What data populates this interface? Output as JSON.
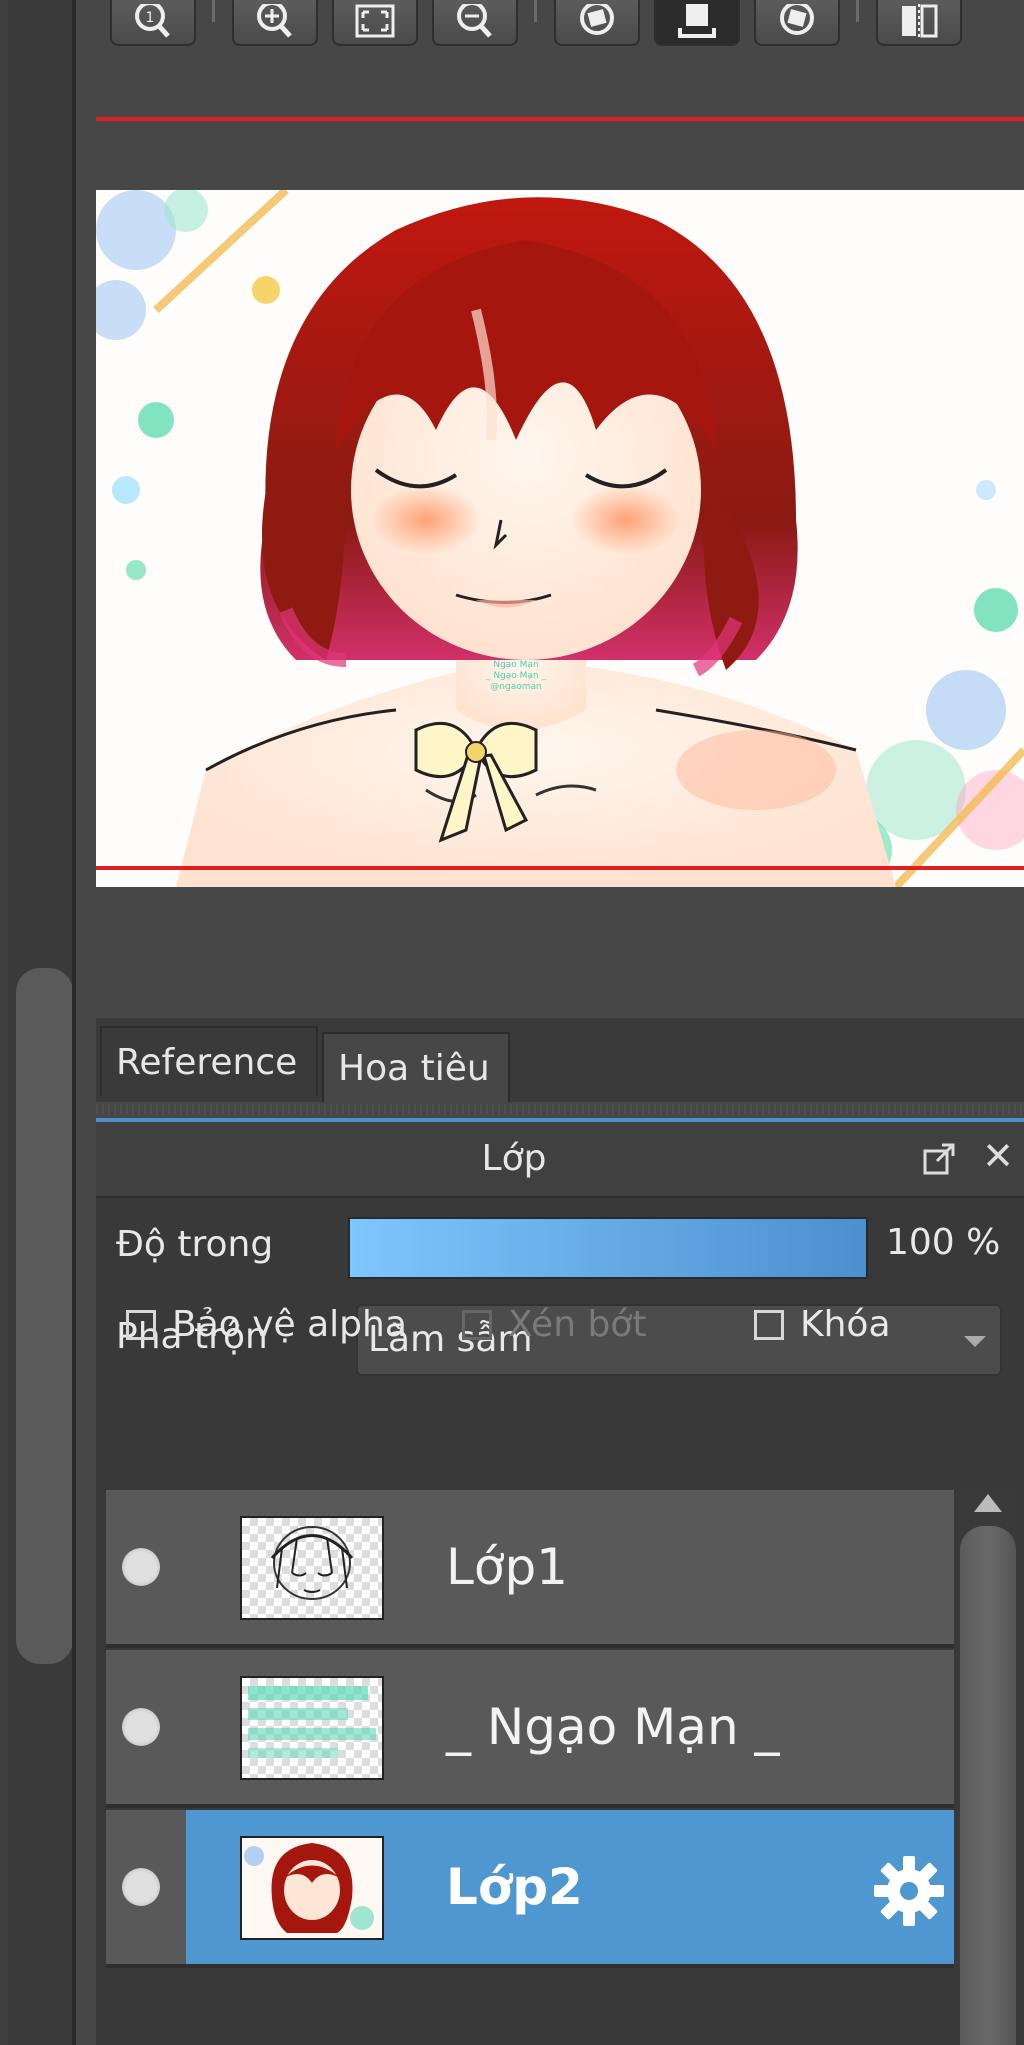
{
  "toolbar": {
    "buttons": [
      {
        "name": "zoom-actual-icon"
      },
      {
        "name": "zoom-in-icon"
      },
      {
        "name": "fit-screen-icon"
      },
      {
        "name": "zoom-out-icon"
      },
      {
        "name": "rotate-left-icon"
      },
      {
        "name": "reset-rotation-icon"
      },
      {
        "name": "rotate-right-icon"
      },
      {
        "name": "flip-horizontal-icon"
      }
    ]
  },
  "canvas": {
    "watermark_lines": [
      "Ngạo Mạn",
      "_ Ngạo Mạn _",
      "@ngaoman"
    ]
  },
  "tabs": [
    {
      "label": "Reference"
    },
    {
      "label": "Hoa tiêu"
    }
  ],
  "layer_panel": {
    "title": "Lớp",
    "opacity_label": "Độ trong",
    "opacity_value": "100 %",
    "opacity_fraction": 1.0,
    "blend_label": "Pha trộn",
    "blend_value": "Làm sẫm",
    "checkboxes": [
      {
        "label": "Bảo vệ alpha",
        "checked": false,
        "enabled": true
      },
      {
        "label": "Xén bớt",
        "checked": false,
        "enabled": false
      },
      {
        "label": "Khóa",
        "checked": false,
        "enabled": true
      }
    ],
    "layers": [
      {
        "name": "Lớp1",
        "selected": false
      },
      {
        "name": "_ Ngạo Mạn _",
        "selected": false
      },
      {
        "name": "Lớp2",
        "selected": true
      }
    ]
  },
  "colors": {
    "accent_blue": "#4e97d0",
    "guide_red": "#e02020",
    "panel_bg": "#393939"
  }
}
